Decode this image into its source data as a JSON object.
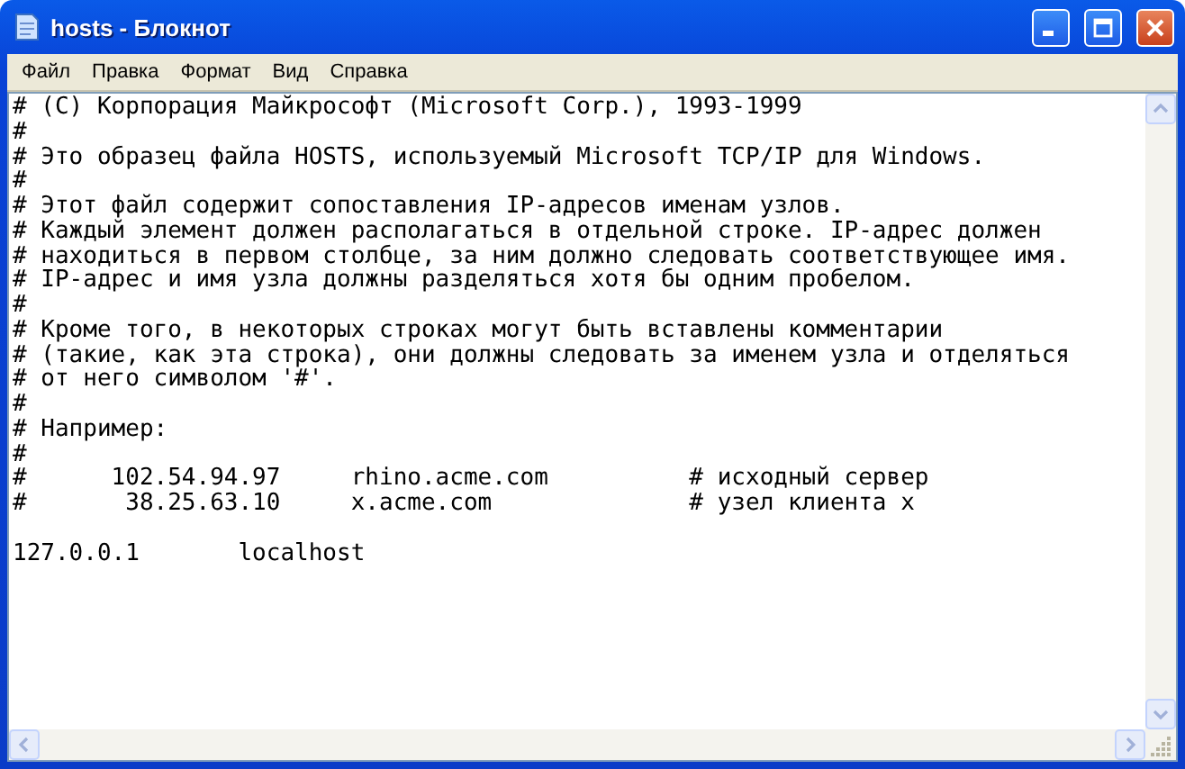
{
  "window": {
    "title": "hosts - Блокнот"
  },
  "menu": [
    "Файл",
    "Правка",
    "Формат",
    "Вид",
    "Справка"
  ],
  "editor": {
    "lines": [
      "# (C) Корпорация Майкрософт (Microsoft Corp.), 1993-1999",
      "#",
      "# Это образец файла HOSTS, используемый Microsoft TCP/IP для Windows.",
      "#",
      "# Этот файл содержит сопоставления IP-адресов именам узлов.",
      "# Каждый элемент должен располагаться в отдельной строке. IP-адрес должен",
      "# находиться в первом столбце, за ним должно следовать соответствующее имя.",
      "# IP-адрес и имя узла должны разделяться хотя бы одним пробелом.",
      "#",
      "# Кроме того, в некоторых строках могут быть вставлены комментарии",
      "# (такие, как эта строка), они должны следовать за именем узла и отделяться",
      "# от него символом '#'.",
      "#",
      "# Например:",
      "#",
      "#      102.54.94.97     rhino.acme.com          # исходный сервер",
      "#       38.25.63.10     x.acme.com              # узел клиента x"
    ],
    "entries": [
      "127.0.0.1       localhost"
    ]
  }
}
